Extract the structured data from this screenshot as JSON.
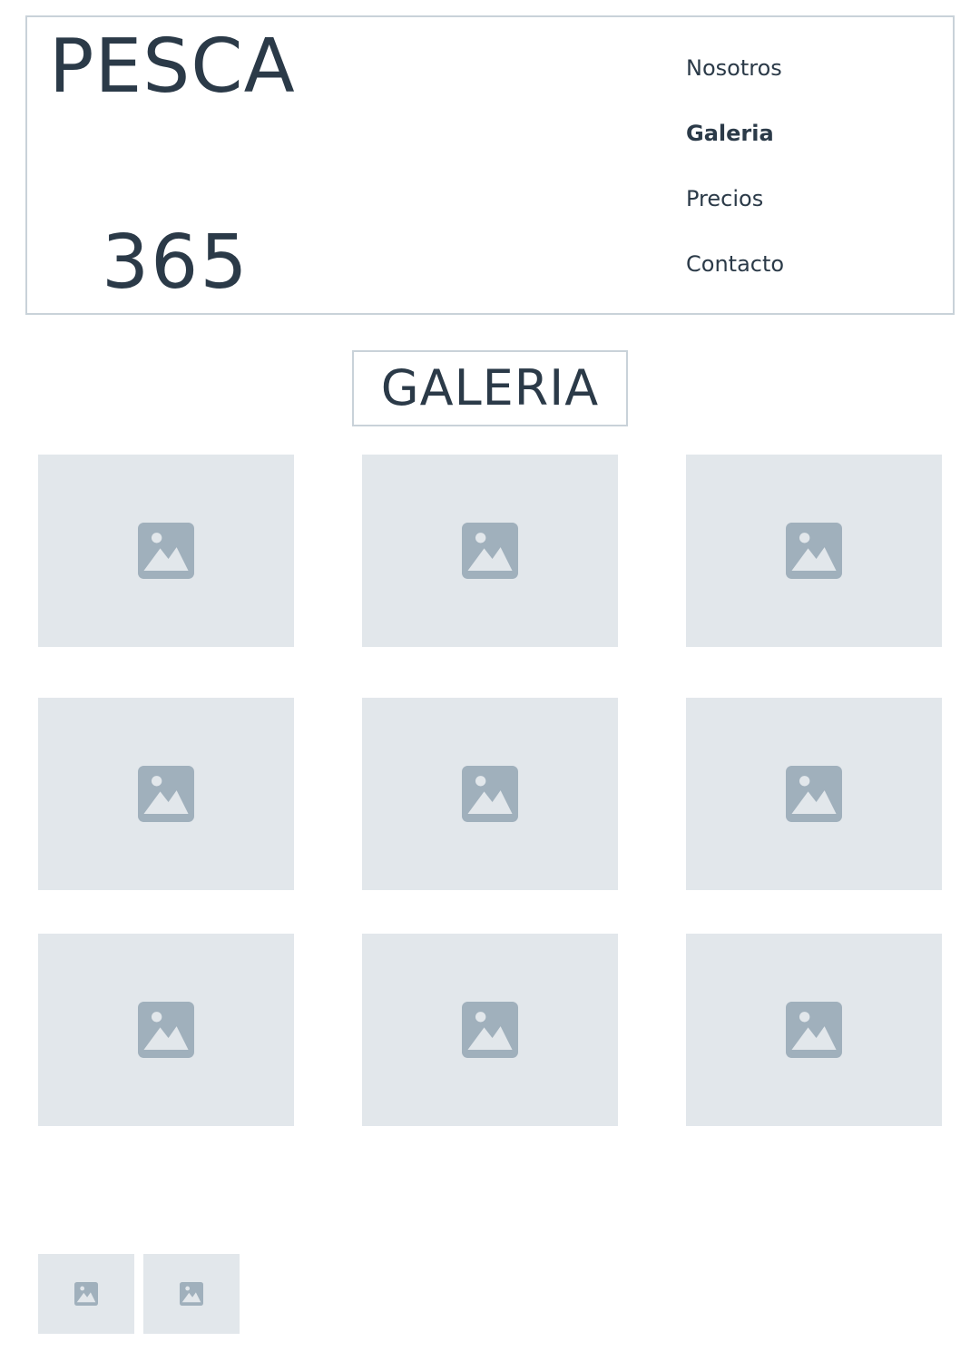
{
  "header": {
    "logo_top": "PESCA",
    "logo_bottom": "365"
  },
  "nav": {
    "items": [
      {
        "label": "Nosotros",
        "active": false
      },
      {
        "label": "Galeria",
        "active": true
      },
      {
        "label": "Precios",
        "active": false
      },
      {
        "label": "Contacto",
        "active": false
      }
    ]
  },
  "gallery": {
    "title": "GALERIA",
    "image_count": 9,
    "thumbnail_count": 2,
    "placeholder_icon": "image-placeholder-icon"
  },
  "colors": {
    "text": "#2b3a48",
    "border": "#c9d2d9",
    "placeholder_bg": "#e2e7eb",
    "placeholder_icon": "#a0b0bc"
  }
}
